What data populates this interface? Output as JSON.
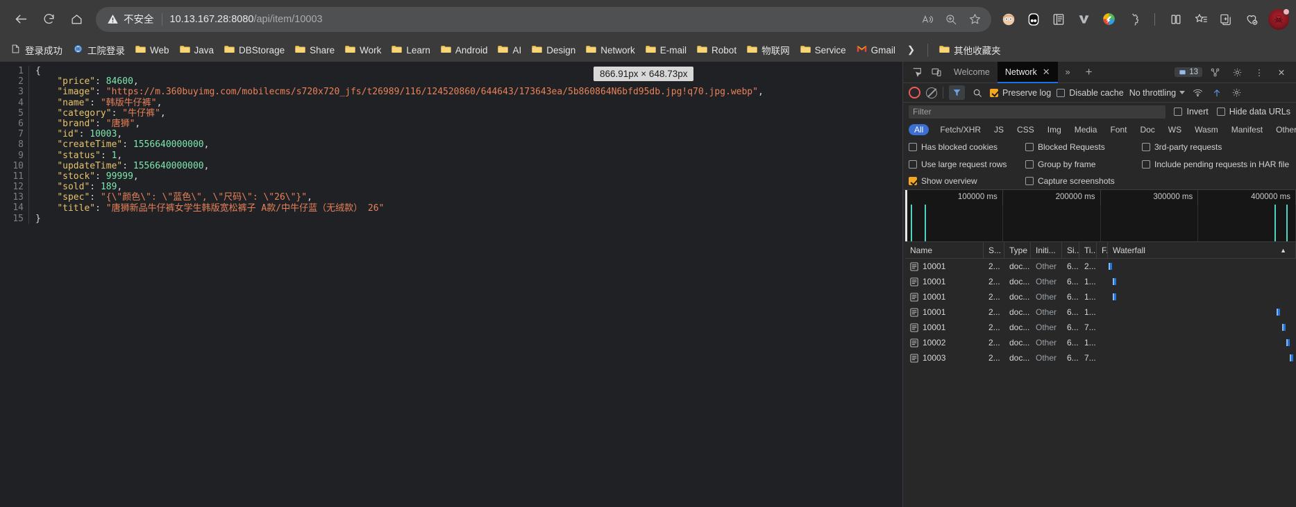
{
  "browser": {
    "nav": {
      "back": "back-arrow",
      "reload": "reload",
      "home": "home"
    },
    "omnibox": {
      "security_label": "不安全",
      "url_host": "10.13.167.28:8080",
      "url_path": "/api/item/10003",
      "actions": [
        "read-aloud",
        "zoom",
        "favorite"
      ]
    },
    "toolbar_icons": [
      "profile-kid",
      "opera-gx",
      "reading-list",
      "v-icon",
      "idm",
      "extension-puzzle",
      "split-screen",
      "favorites-list",
      "collections",
      "browser-essentials"
    ],
    "bookmarks": [
      {
        "label": "登录成功",
        "icon": "page-icon"
      },
      {
        "label": "工院登录",
        "icon": "globe-icon"
      },
      {
        "label": "Web",
        "icon": "folder-icon"
      },
      {
        "label": "Java",
        "icon": "folder-icon"
      },
      {
        "label": "DBStorage",
        "icon": "folder-icon"
      },
      {
        "label": "Share",
        "icon": "folder-icon"
      },
      {
        "label": "Work",
        "icon": "folder-icon"
      },
      {
        "label": "Learn",
        "icon": "folder-icon"
      },
      {
        "label": "Android",
        "icon": "folder-icon"
      },
      {
        "label": "AI",
        "icon": "folder-icon"
      },
      {
        "label": "Design",
        "icon": "folder-icon"
      },
      {
        "label": "Network",
        "icon": "folder-icon"
      },
      {
        "label": "E-mail",
        "icon": "folder-icon"
      },
      {
        "label": "Robot",
        "icon": "folder-icon"
      },
      {
        "label": "物联网",
        "icon": "folder-icon"
      },
      {
        "label": "Service",
        "icon": "folder-icon"
      },
      {
        "label": "Gmail",
        "icon": "gmail-icon"
      }
    ],
    "bookmarks_overflow": "»",
    "other_bookmarks": "其他收藏夹"
  },
  "json_response": {
    "line_numbers": [
      "1",
      "2",
      "3",
      "4",
      "5",
      "6",
      "7",
      "8",
      "9",
      "10",
      "11",
      "12",
      "13",
      "14",
      "15"
    ],
    "lines": [
      {
        "n": "1",
        "tokens": [
          {
            "t": "{",
            "c": "p"
          }
        ]
      },
      {
        "n": "2",
        "tokens": [
          {
            "t": "    \"price\"",
            "c": "k"
          },
          {
            "t": ": ",
            "c": "p"
          },
          {
            "t": "84600",
            "c": "n"
          },
          {
            "t": ",",
            "c": "p"
          }
        ]
      },
      {
        "n": "3",
        "tokens": [
          {
            "t": "    \"image\"",
            "c": "k"
          },
          {
            "t": ": ",
            "c": "p"
          },
          {
            "t": "\"https://m.360buyimg.com/mobilecms/s720x720_jfs/t26989/116/124520860/644643/173643ea/5b860864N6bfd95db.jpg!q70.jpg.webp\"",
            "c": "s"
          },
          {
            "t": ",",
            "c": "p"
          }
        ]
      },
      {
        "n": "4",
        "tokens": [
          {
            "t": "    \"name\"",
            "c": "k"
          },
          {
            "t": ": ",
            "c": "p"
          },
          {
            "t": "\"韩版牛仔裤\"",
            "c": "s"
          },
          {
            "t": ",",
            "c": "p"
          }
        ]
      },
      {
        "n": "5",
        "tokens": [
          {
            "t": "    \"category\"",
            "c": "k"
          },
          {
            "t": ": ",
            "c": "p"
          },
          {
            "t": "\"牛仔裤\"",
            "c": "s"
          },
          {
            "t": ",",
            "c": "p"
          }
        ]
      },
      {
        "n": "6",
        "tokens": [
          {
            "t": "    \"brand\"",
            "c": "k"
          },
          {
            "t": ": ",
            "c": "p"
          },
          {
            "t": "\"唐狮\"",
            "c": "s"
          },
          {
            "t": ",",
            "c": "p"
          }
        ]
      },
      {
        "n": "7",
        "tokens": [
          {
            "t": "    \"id\"",
            "c": "k"
          },
          {
            "t": ": ",
            "c": "p"
          },
          {
            "t": "10003",
            "c": "n"
          },
          {
            "t": ",",
            "c": "p"
          }
        ]
      },
      {
        "n": "8",
        "tokens": [
          {
            "t": "    \"createTime\"",
            "c": "k"
          },
          {
            "t": ": ",
            "c": "p"
          },
          {
            "t": "1556640000000",
            "c": "n"
          },
          {
            "t": ",",
            "c": "p"
          }
        ]
      },
      {
        "n": "9",
        "tokens": [
          {
            "t": "    \"status\"",
            "c": "k"
          },
          {
            "t": ": ",
            "c": "p"
          },
          {
            "t": "1",
            "c": "n"
          },
          {
            "t": ",",
            "c": "p"
          }
        ]
      },
      {
        "n": "10",
        "tokens": [
          {
            "t": "    \"updateTime\"",
            "c": "k"
          },
          {
            "t": ": ",
            "c": "p"
          },
          {
            "t": "1556640000000",
            "c": "n"
          },
          {
            "t": ",",
            "c": "p"
          }
        ]
      },
      {
        "n": "11",
        "tokens": [
          {
            "t": "    \"stock\"",
            "c": "k"
          },
          {
            "t": ": ",
            "c": "p"
          },
          {
            "t": "99999",
            "c": "n"
          },
          {
            "t": ",",
            "c": "p"
          }
        ]
      },
      {
        "n": "12",
        "tokens": [
          {
            "t": "    \"sold\"",
            "c": "k"
          },
          {
            "t": ": ",
            "c": "p"
          },
          {
            "t": "189",
            "c": "n"
          },
          {
            "t": ",",
            "c": "p"
          }
        ]
      },
      {
        "n": "13",
        "tokens": [
          {
            "t": "    \"spec\"",
            "c": "k"
          },
          {
            "t": ": ",
            "c": "p"
          },
          {
            "t": "\"{\\\"颜色\\\": \\\"蓝色\\\", \\\"尺码\\\": \\\"26\\\"}\"",
            "c": "s"
          },
          {
            "t": ",",
            "c": "p"
          }
        ]
      },
      {
        "n": "14",
        "tokens": [
          {
            "t": "    \"title\"",
            "c": "k"
          },
          {
            "t": ": ",
            "c": "p"
          },
          {
            "t": "\"唐狮新品牛仔裤女学生韩版宽松裤子 A款/中牛仔蓝（无绒款） 26\"",
            "c": "s"
          }
        ]
      },
      {
        "n": "15",
        "tokens": [
          {
            "t": "}",
            "c": "p"
          }
        ]
      }
    ]
  },
  "size_tooltip": "866.91px × 648.73px",
  "devtools": {
    "tabs": [
      {
        "label": "Welcome",
        "active": false
      },
      {
        "label": "Network",
        "active": true,
        "closable": true
      }
    ],
    "overflow": "»",
    "add_tab": "+",
    "issues_count": "13",
    "toolbar": {
      "record": "record-button",
      "clear": "clear-button",
      "filter": "filter-button",
      "search": "search-button",
      "preserve_log": "Preserve log",
      "preserve_log_checked": true,
      "disable_cache": "Disable cache",
      "disable_cache_checked": false,
      "throttling": "No throttling",
      "import_har": "import-har",
      "export_har": "export-har",
      "settings": "settings-gear",
      "wifi": "network-conditions"
    },
    "filter": {
      "placeholder": "Filter",
      "invert": "Invert",
      "invert_checked": false,
      "hide_data_urls": "Hide data URLs",
      "hide_data_urls_checked": false
    },
    "type_filters": [
      "All",
      "Fetch/XHR",
      "JS",
      "CSS",
      "Img",
      "Media",
      "Font",
      "Doc",
      "WS",
      "Wasm",
      "Manifest",
      "Other"
    ],
    "type_filter_selected": "All",
    "options": [
      {
        "label": "Has blocked cookies",
        "checked": false
      },
      {
        "label": "Blocked Requests",
        "checked": false
      },
      {
        "label": "3rd-party requests",
        "checked": false
      },
      {
        "label": "Use large request rows",
        "checked": false
      },
      {
        "label": "Group by frame",
        "checked": false
      },
      {
        "label": "Include pending requests in HAR file",
        "checked": false
      },
      {
        "label": "Show overview",
        "checked": true
      },
      {
        "label": "Capture screenshots",
        "checked": false
      }
    ],
    "overview": {
      "ticks": [
        "100000 ms",
        "200000 ms",
        "300000 ms",
        "400000 ms"
      ],
      "spikes_pct": [
        1.5,
        5.0,
        94.5,
        97.5
      ]
    },
    "table": {
      "columns": [
        "Name",
        "S...",
        "Type",
        "Initi...",
        "Si...",
        "Ti...",
        "F.",
        "Waterfall"
      ],
      "rows": [
        {
          "name": "10001",
          "status": "2...",
          "type": "doc...",
          "initiator": "Other",
          "size": "6...",
          "time": "2...",
          "f": "",
          "wf_left_pct": 0.3,
          "wf_w_pct": 1.0
        },
        {
          "name": "10001",
          "status": "2...",
          "type": "doc...",
          "initiator": "Other",
          "size": "6...",
          "time": "1...",
          "f": "",
          "wf_left_pct": 2.5,
          "wf_w_pct": 1.0
        },
        {
          "name": "10001",
          "status": "2...",
          "type": "doc...",
          "initiator": "Other",
          "size": "6...",
          "time": "1...",
          "f": "",
          "wf_left_pct": 2.5,
          "wf_w_pct": 1.0
        },
        {
          "name": "10001",
          "status": "2...",
          "type": "doc...",
          "initiator": "Other",
          "size": "6...",
          "time": "1...",
          "f": "",
          "wf_left_pct": 89.5,
          "wf_w_pct": 1.0
        },
        {
          "name": "10001",
          "status": "2...",
          "type": "doc...",
          "initiator": "Other",
          "size": "6...",
          "time": "7...",
          "f": "",
          "wf_left_pct": 92.5,
          "wf_w_pct": 1.0
        },
        {
          "name": "10002",
          "status": "2...",
          "type": "doc...",
          "initiator": "Other",
          "size": "6...",
          "time": "1...",
          "f": "",
          "wf_left_pct": 95.0,
          "wf_w_pct": 1.0
        },
        {
          "name": "10003",
          "status": "2...",
          "type": "doc...",
          "initiator": "Other",
          "size": "6...",
          "time": "7...",
          "f": "",
          "wf_left_pct": 96.5,
          "wf_w_pct": 1.0
        }
      ]
    }
  }
}
